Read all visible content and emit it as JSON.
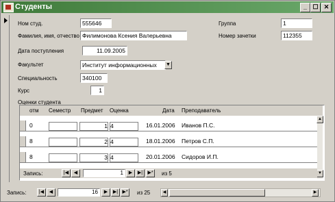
{
  "window": {
    "title": "Студенты",
    "min": "_",
    "max": "☐",
    "close": "✕"
  },
  "form": {
    "labels": {
      "student": "Ном студ.",
      "fio": "Фамилия, имя, отчество",
      "date": "Дата поступления",
      "faculty": "Факультет",
      "specialty": "Специальность",
      "course": "Курс",
      "group": "Группа",
      "book": "Номер зачетки",
      "grades": "Оценки студента"
    },
    "values": {
      "student": "555646",
      "fio": "Филимонова Ксения Валерьевна",
      "date": "11.09.2005",
      "faculty": "Институт информационных",
      "specialty": "340100",
      "course": "1",
      "group": "1",
      "book": "112355"
    }
  },
  "subform": {
    "headers": [
      "отм",
      "Семестр",
      "Предмет",
      "Оценка",
      "Дата",
      "Преподаватель"
    ],
    "rows": [
      {
        "otm": "0",
        "semestr": "",
        "predmet": "1",
        "ocenka": "4",
        "data": "16.01.2006",
        "prepod": "Иванов П.С."
      },
      {
        "otm": "8",
        "semestr": "",
        "predmet": "2",
        "ocenka": "4",
        "data": "18.01.2006",
        "prepod": "Петров С.П."
      },
      {
        "otm": "8",
        "semestr": "",
        "predmet": "3",
        "ocenka": "4",
        "data": "20.01.2006",
        "prepod": "Сидоров И.П."
      }
    ],
    "nav": {
      "label": "Запись:",
      "current": "1",
      "of": "из 5"
    }
  },
  "record_nav": {
    "label": "Запись:",
    "current": "16",
    "of": "из 25"
  }
}
